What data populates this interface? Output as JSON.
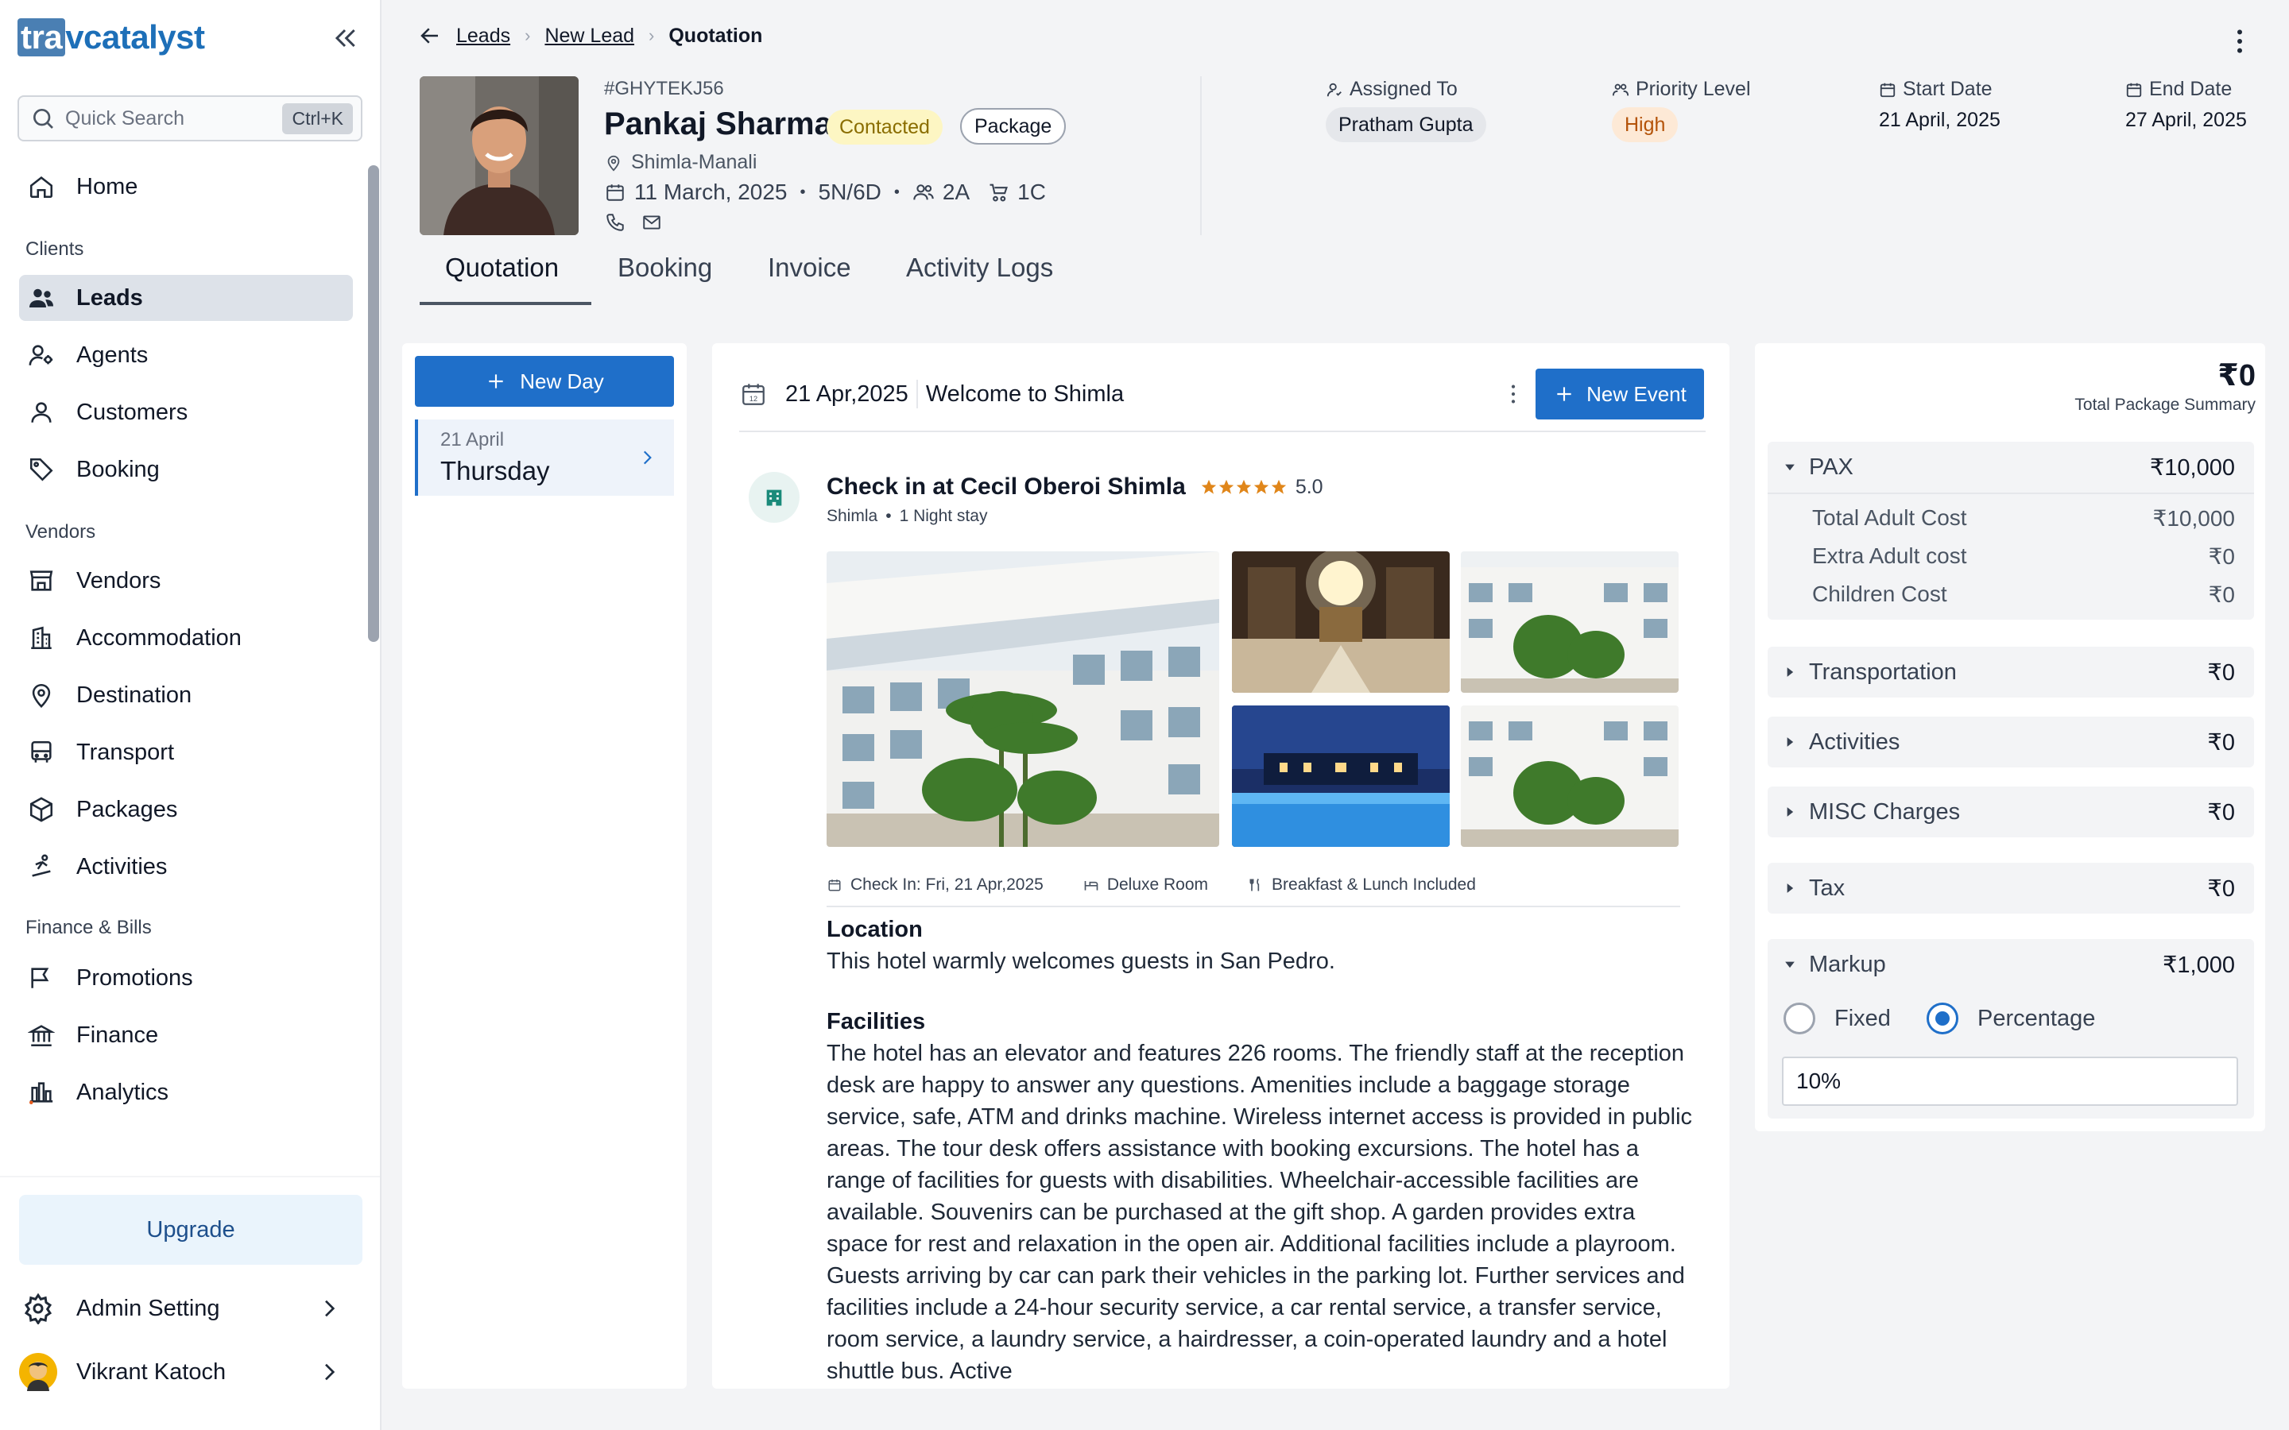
{
  "app": {
    "logo_prefix": "tra",
    "logo_rest": "vcatalyst"
  },
  "search": {
    "placeholder": "Quick Search",
    "shortcut": "Ctrl+K"
  },
  "sidebar": {
    "home": "Home",
    "section_clients": "Clients",
    "leads": "Leads",
    "agents": "Agents",
    "customers": "Customers",
    "booking": "Booking",
    "section_vendors": "Vendors",
    "vendors": "Vendors",
    "accommodation": "Accommodation",
    "destination": "Destination",
    "transport": "Transport",
    "packages": "Packages",
    "activities": "Activities",
    "section_finance": "Finance & Bills",
    "promotions": "Promotions",
    "finance": "Finance",
    "analytics": "Analytics",
    "upgrade": "Upgrade",
    "admin_setting": "Admin Setting",
    "user_name": "Vikrant Katoch"
  },
  "breadcrumb": {
    "level1": "Leads",
    "level2": "New Lead",
    "current": "Quotation"
  },
  "lead": {
    "id": "#GHYTEKJ56",
    "name": "Pankaj Sharma",
    "status": "Contacted",
    "type": "Package",
    "location": "Shimla-Manali",
    "date": "11 March, 2025",
    "duration": "5N/6D",
    "adults": "2A",
    "children": "1C"
  },
  "meta": {
    "assigned_label": "Assigned To",
    "assigned_value": "Pratham Gupta",
    "priority_label": "Priority Level",
    "priority_value": "High",
    "start_label": "Start Date",
    "start_value": "21 April, 2025",
    "end_label": "End Date",
    "end_value": "27 April, 2025"
  },
  "tabs": {
    "quotation": "Quotation",
    "booking": "Booking",
    "invoice": "Invoice",
    "activity": "Activity Logs"
  },
  "days": {
    "new_day": "New Day",
    "items": [
      {
        "date": "21 April",
        "weekday": "Thursday"
      }
    ]
  },
  "event": {
    "date": "21 Apr,2025",
    "title": "Welcome to Shimla",
    "new_event": "New Event",
    "hotel_name": "Check in at Cecil Oberoi Shimla",
    "rating": "5.0",
    "rating_stars": 5,
    "hotel_city": "Shimla",
    "hotel_stay": "1 Night stay",
    "checkin": "Check In: Fri, 21 Apr,2025",
    "room": "Deluxe Room",
    "meals": "Breakfast & Lunch Included",
    "location_heading": "Location",
    "location_text": "This hotel warmly welcomes guests in San Pedro.",
    "facilities_heading": "Facilities",
    "facilities_text": "The hotel has an elevator and features 226 rooms. The friendly staff at the reception desk are happy to answer any questions. Amenities include a baggage storage service, safe, ATM and drinks machine. Wireless internet access is provided in public areas. The tour desk offers assistance with booking excursions. The hotel has a range of facilities for guests with disabilities. Wheelchair-accessible facilities are available. Souvenirs can be purchased at the gift shop. A garden provides extra space for rest and relaxation in the open air. Additional facilities include a playroom. Guests arriving by car can park their vehicles in the parking lot. Further services and facilities include a 24-hour security service, a car rental service, a transfer service, room service, a laundry service, a hairdresser, a coin-operated laundry and a hotel shuttle bus. Active"
  },
  "summary": {
    "total": "₹0",
    "caption": "Total Package Summary",
    "pax_label": "PAX",
    "pax_amount": "₹10,000",
    "total_adult_label": "Total Adult Cost",
    "total_adult_amount": "₹10,000",
    "extra_adult_label": "Extra Adult cost",
    "extra_adult_amount": "₹0",
    "children_label": "Children Cost",
    "children_amount": "₹0",
    "transportation_label": "Transportation",
    "transportation_amount": "₹0",
    "activities_label": "Activities",
    "activities_amount": "₹0",
    "misc_label": "MISC Charges",
    "misc_amount": "₹0",
    "tax_label": "Tax",
    "tax_amount": "₹0",
    "markup_label": "Markup",
    "markup_amount": "₹1,000",
    "fixed_label": "Fixed",
    "percentage_label": "Percentage",
    "markup_value": "10%"
  },
  "colors": {
    "primary": "#1f6fc9",
    "status_bg": "#fdf6c3",
    "priority_bg": "#fde9d6"
  }
}
